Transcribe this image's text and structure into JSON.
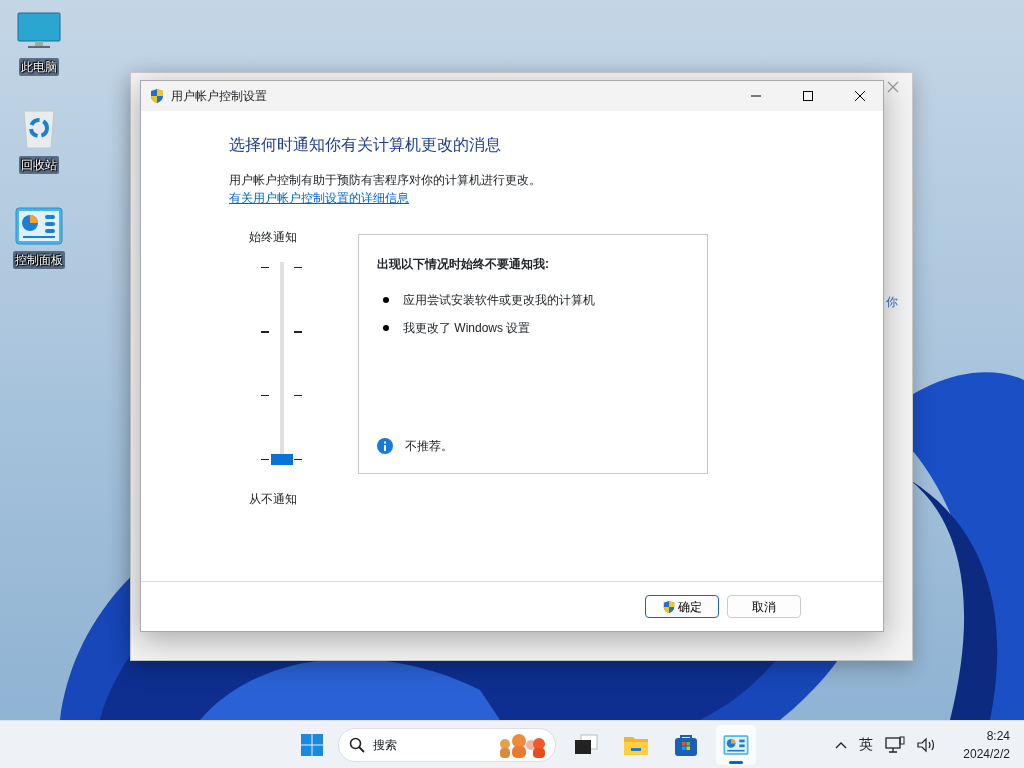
{
  "desktop_icons": [
    {
      "kind": "computer",
      "label": "此电脑"
    },
    {
      "kind": "recycle",
      "label": "回收站"
    },
    {
      "kind": "control-panel",
      "label": "控制面板"
    }
  ],
  "back_window": {
    "text": "你"
  },
  "dialog": {
    "title": "用户帐户控制设置",
    "heading": "选择何时通知你有关计算机更改的消息",
    "description": "用户帐户控制有助于预防有害程序对你的计算机进行更改。",
    "link": "有关用户帐户控制设置的详细信息",
    "top_label": "始终通知",
    "bottom_label": "从不通知",
    "slider": {
      "level": 0
    },
    "info_box": {
      "title": "出现以下情况时始终不要通知我:",
      "items": [
        "应用尝试安装软件或更改我的计算机",
        "我更改了 Windows 设置"
      ],
      "note": "不推荐。"
    },
    "buttons": [
      {
        "label": "确定",
        "kind": "shield",
        "default": true
      },
      {
        "label": "取消",
        "kind": "plain",
        "default": false
      }
    ]
  },
  "taskbar": {
    "search_placeholder": "搜索",
    "apps": [
      {
        "kind": "task-view",
        "active": false
      },
      {
        "kind": "folder",
        "active": false
      },
      {
        "kind": "store",
        "active": false
      },
      {
        "kind": "control-panel",
        "active": true
      }
    ],
    "tray": {
      "language": "英",
      "time": "8:24",
      "date": "2024/2/2"
    }
  }
}
